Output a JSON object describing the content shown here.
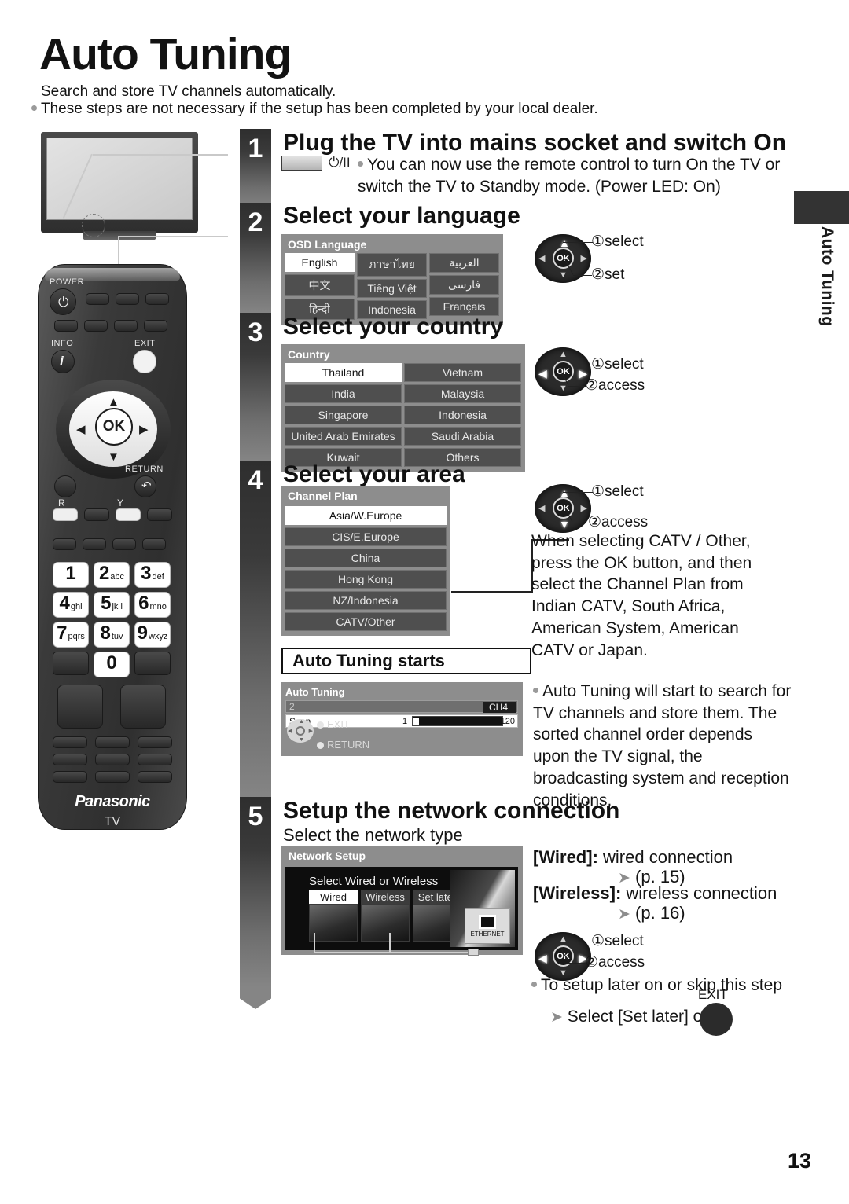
{
  "page": {
    "title": "Auto Tuning",
    "subtitle": "Search and store TV channels automatically.",
    "dealer_note": "These steps are not necessary if the setup has been completed by your local dealer.",
    "side_tab": "Auto Tuning",
    "page_number": "13"
  },
  "steps": [
    {
      "number": "1",
      "heading": "Plug the TV into mains socket and switch On",
      "power_symbol": "⏻/II",
      "body": "You can now use the remote control to turn On the TV or switch the TV to Standby mode. (Power LED: On)"
    },
    {
      "number": "2",
      "heading": "Select your language",
      "pad_labels": [
        "①select",
        "②set"
      ]
    },
    {
      "number": "3",
      "heading": "Select your country",
      "pad_labels": [
        "①select",
        "②access"
      ]
    },
    {
      "number": "4",
      "heading": "Select your area",
      "pad_labels": [
        "①select",
        "②access"
      ],
      "catv_note": "When selecting CATV / Other, press the OK button, and then select the Channel Plan from Indian CATV, South Africa, American System, American CATV or Japan."
    },
    {
      "number": "5",
      "heading": "Setup the network connection",
      "subheading": "Select the network type",
      "pad_labels": [
        "①select",
        "②access"
      ],
      "wired_label": "[Wired]:",
      "wired_text": "wired connection",
      "wired_page": "(p. 15)",
      "wireless_label": "[Wireless]:",
      "wireless_text": "wireless connection",
      "wireless_page": "(p. 16)",
      "skip_note": "To setup later on or skip this step",
      "skip_action": "Select [Set later] or",
      "exit_label": "EXIT"
    }
  ],
  "osd_language": {
    "title": "OSD Language",
    "columns": [
      [
        "English",
        "中文",
        "हिन्दी"
      ],
      [
        "ภาษาไทย",
        "Tiếng Việt",
        "Indonesia"
      ],
      [
        "العربية",
        "فارسی",
        "Français"
      ]
    ],
    "selected": "English"
  },
  "osd_country": {
    "title": "Country",
    "columns": [
      [
        "Thailand",
        "India",
        "Singapore",
        "United Arab Emirates",
        "Kuwait"
      ],
      [
        "Vietnam",
        "Malaysia",
        "Indonesia",
        "Saudi Arabia",
        "Others"
      ]
    ],
    "selected": "Thailand"
  },
  "osd_channel_plan": {
    "title": "Channel Plan",
    "items": [
      "Asia/W.Europe",
      "CIS/E.Europe",
      "China",
      "Hong Kong",
      "NZ/Indonesia",
      "CATV/Other"
    ],
    "selected": "Asia/W.Europe"
  },
  "auto_tuning_box": {
    "heading": "Auto Tuning starts",
    "body": "Auto Tuning will start to search for TV channels and store them. The sorted channel order depends upon the TV signal, the broadcasting system and reception conditions."
  },
  "osd_auto_tuning": {
    "title": "Auto Tuning",
    "channel_count": "2",
    "channel_badge": "CH4",
    "scan_label": "Scan",
    "scan_from": "1",
    "scan_to": "120",
    "key_exit": "EXIT",
    "key_return": "RETURN"
  },
  "osd_network": {
    "title": "Network Setup",
    "prompt": "Select Wired or Wireless",
    "options": [
      "Wired",
      "Wireless",
      "Set later"
    ],
    "selected": "Wired",
    "ethernet_label": "ETHERNET"
  },
  "remote": {
    "power_label": "POWER",
    "info_label": "INFO",
    "exit_label": "EXIT",
    "return_label": "RETURN",
    "ok_label": "OK",
    "red_label": "R",
    "yellow_label": "Y",
    "brand": "Panasonic",
    "device": "TV",
    "numeric_keys": [
      {
        "digit": "1",
        "letters": ""
      },
      {
        "digit": "2",
        "letters": "abc"
      },
      {
        "digit": "3",
        "letters": "def"
      },
      {
        "digit": "4",
        "letters": "ghi"
      },
      {
        "digit": "5",
        "letters": "jk l"
      },
      {
        "digit": "6",
        "letters": "mno"
      },
      {
        "digit": "7",
        "letters": "pqrs"
      },
      {
        "digit": "8",
        "letters": "tuv"
      },
      {
        "digit": "9",
        "letters": "wxyz"
      },
      {
        "digit": "0",
        "letters": ""
      }
    ]
  },
  "colors": {
    "osd_bg": "#8d8d8d",
    "osd_item": "#4f4f4f",
    "step_bar_dark": "#2e2e2e",
    "step_bar_light": "#858585"
  }
}
